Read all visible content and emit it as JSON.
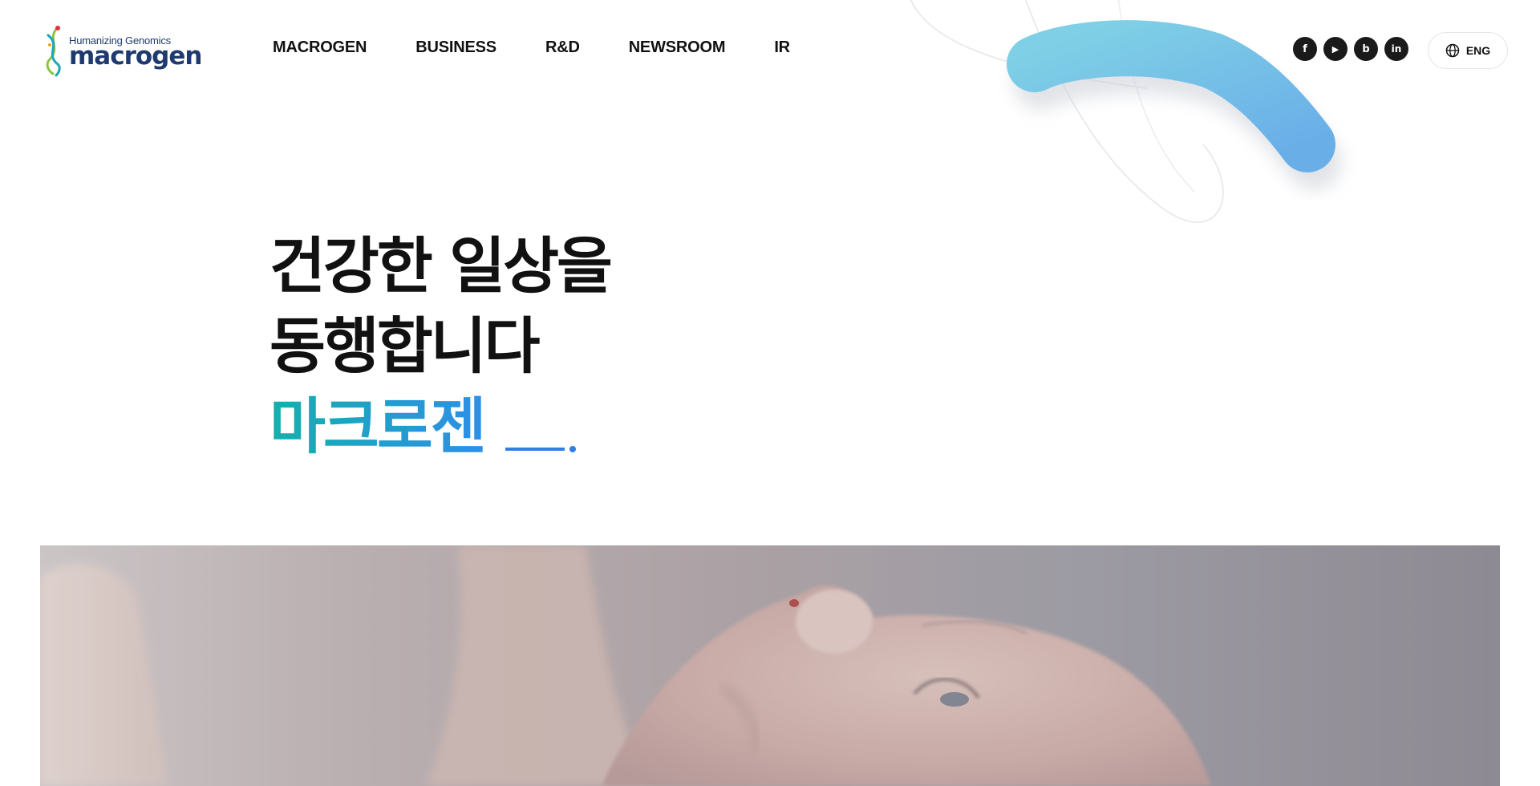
{
  "logo": {
    "tagline": "Humanizing Genomics",
    "wordmark": "macrogen",
    "brand_color": "#1f3a6e"
  },
  "nav": {
    "items": [
      {
        "label": "MACROGEN"
      },
      {
        "label": "BUSINESS"
      },
      {
        "label": "R&D"
      },
      {
        "label": "NEWSROOM"
      },
      {
        "label": "IR"
      }
    ]
  },
  "social": {
    "items": [
      {
        "icon": "facebook-icon",
        "glyph": "f"
      },
      {
        "icon": "youtube-icon",
        "glyph": "▶"
      },
      {
        "icon": "blog-icon",
        "glyph": "b"
      },
      {
        "icon": "linkedin-icon",
        "glyph": "in"
      }
    ]
  },
  "language": {
    "label": "ENG",
    "icon": "globe-icon"
  },
  "hero": {
    "line1": "건강한 일상을",
    "line2": "동행합니다",
    "brand": "마크로젠",
    "gradient": [
      "#14b0ac",
      "#2f8ee8"
    ],
    "accent_color": "#2f7fe6"
  },
  "visual": {
    "image": "baby-photo"
  }
}
